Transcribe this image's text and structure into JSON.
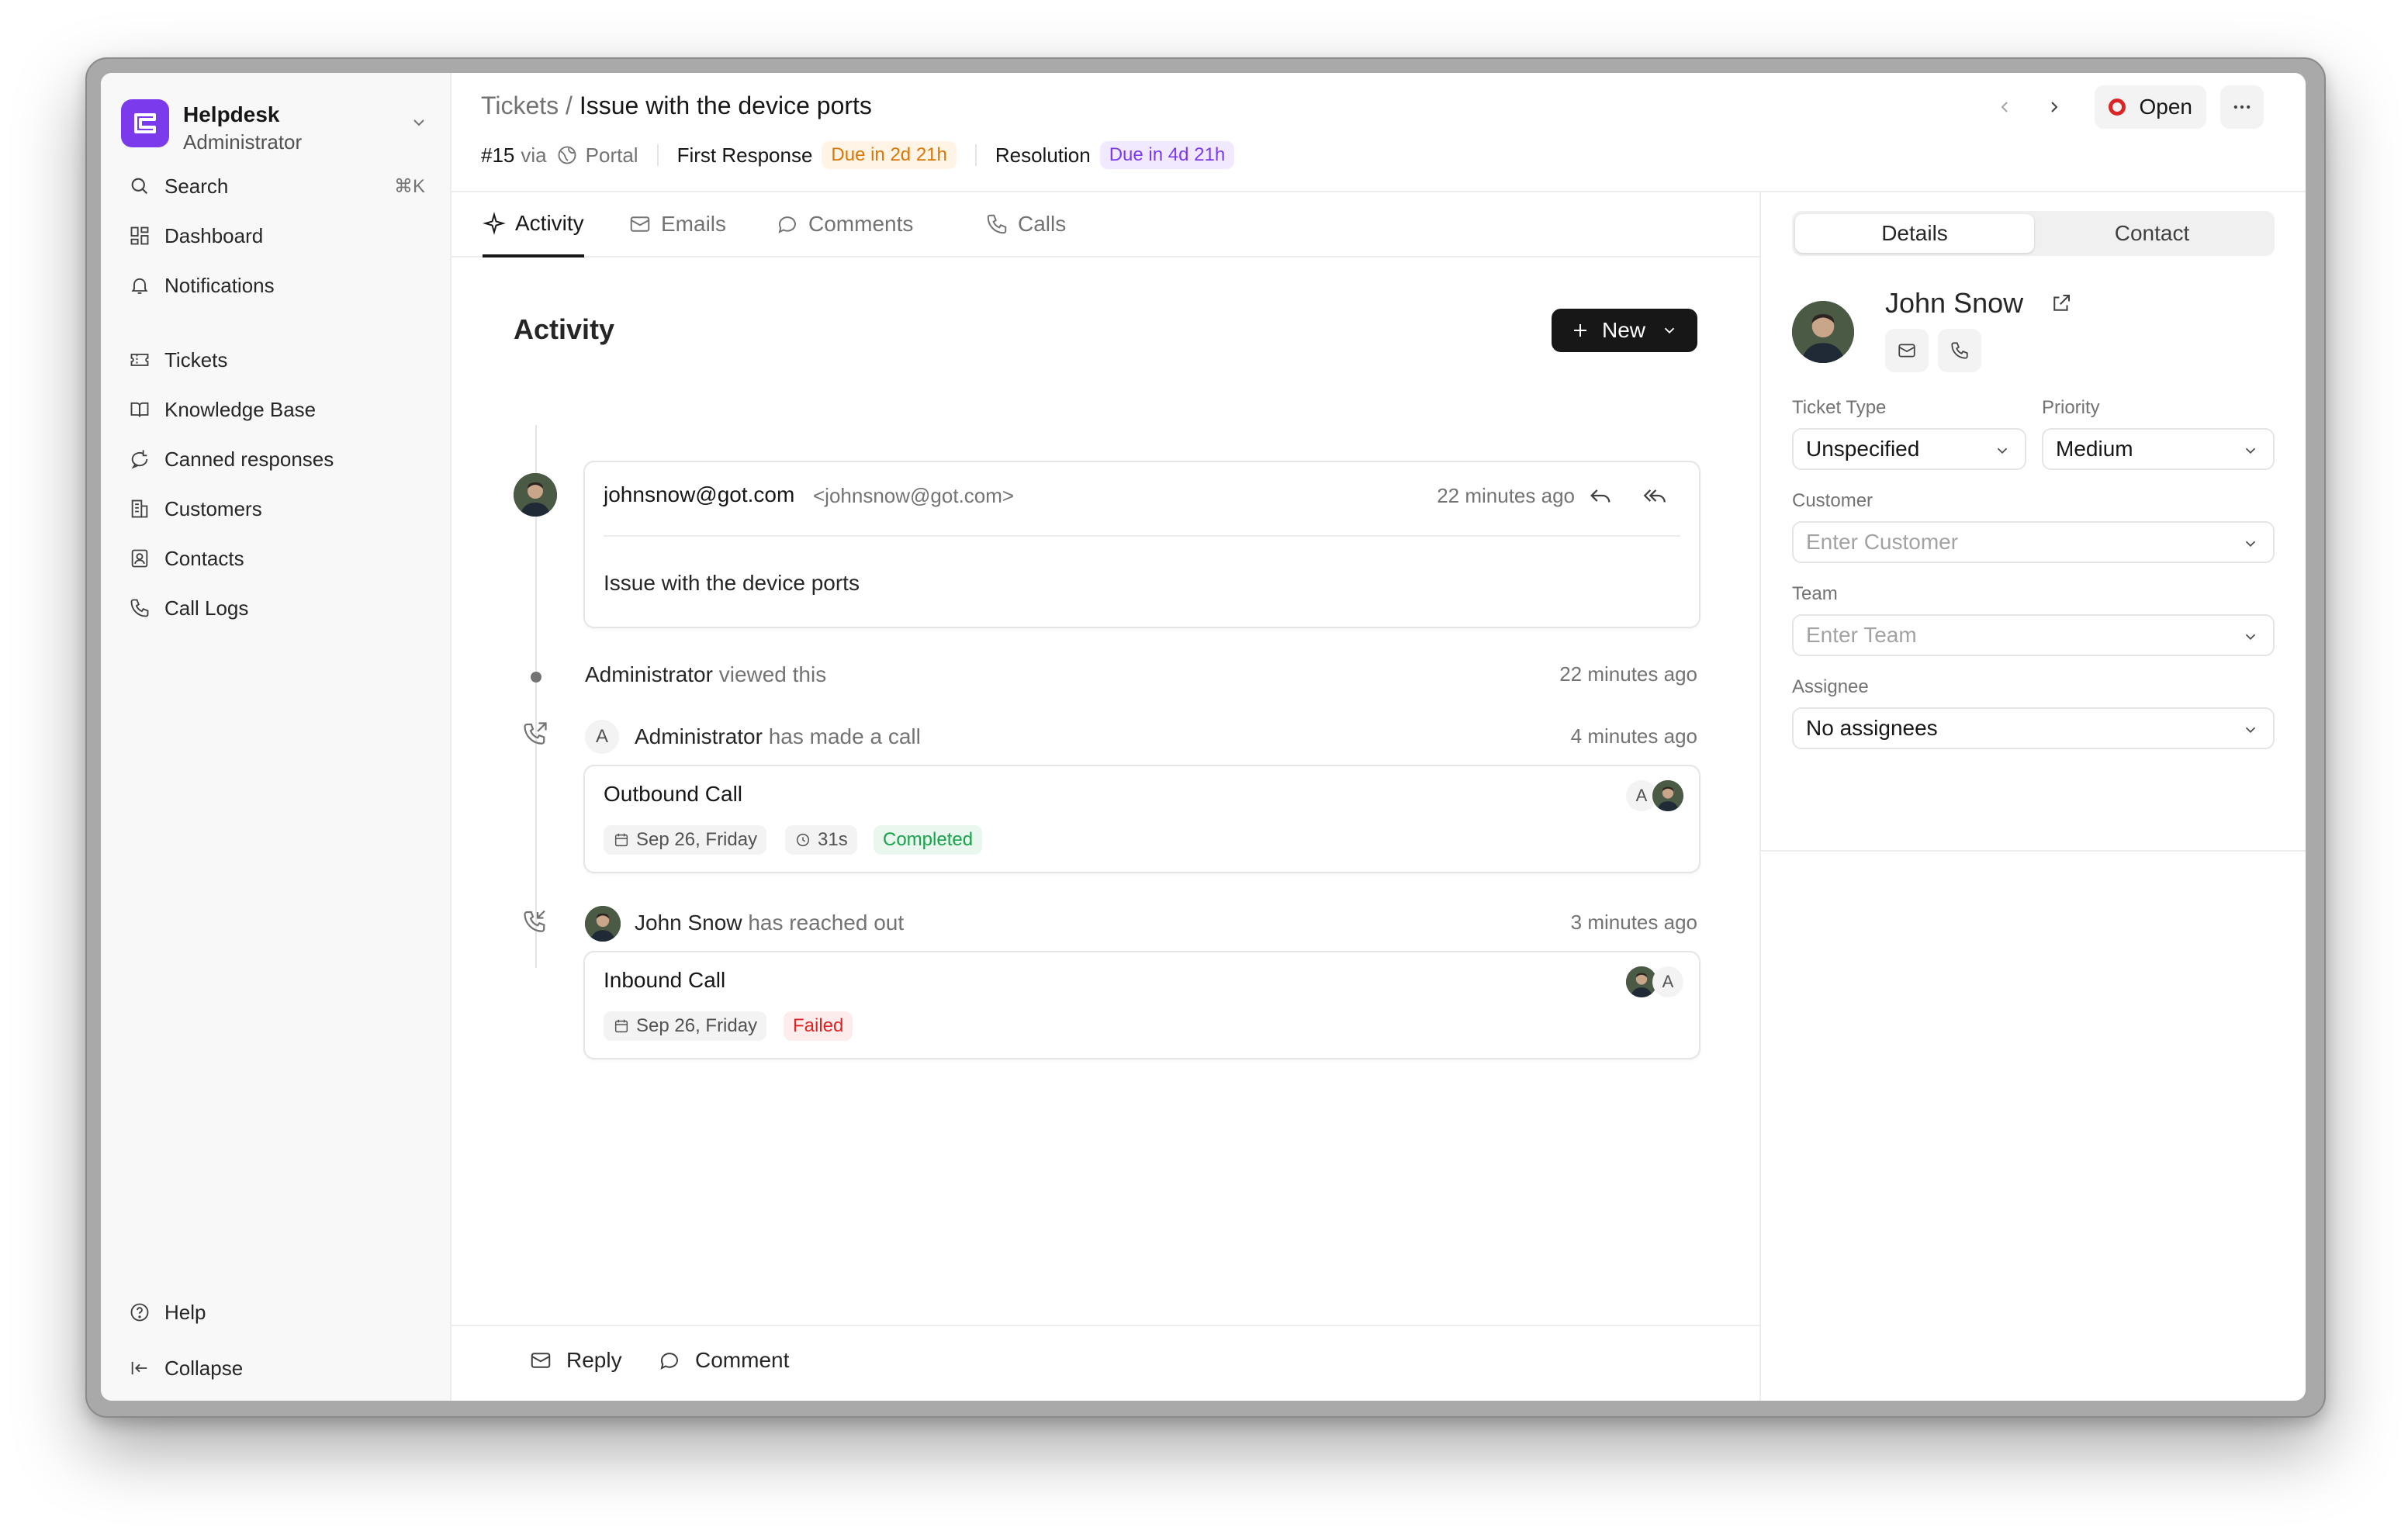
{
  "app": {
    "name": "Helpdesk",
    "role": "Administrator"
  },
  "sidebar": {
    "search": {
      "label": "Search",
      "shortcut": "⌘K"
    },
    "dashboard": "Dashboard",
    "notifications": "Notifications",
    "tickets": "Tickets",
    "knowledge_base": "Knowledge Base",
    "canned_responses": "Canned responses",
    "customers": "Customers",
    "contacts": "Contacts",
    "call_logs": "Call Logs",
    "help": "Help",
    "collapse": "Collapse"
  },
  "header": {
    "breadcrumb_root": "Tickets",
    "breadcrumb_sep": "/",
    "ticket_title": "Issue with the device ports",
    "ticket_id": "#15",
    "via": "via",
    "source": "Portal",
    "first_response_label": "First Response",
    "first_response_due": "Due in 2d 21h",
    "resolution_label": "Resolution",
    "resolution_due": "Due in 4d 21h",
    "status": "Open",
    "status_color": "#dc2626"
  },
  "tabs": [
    "Activity",
    "Emails",
    "Comments",
    "Calls"
  ],
  "activity": {
    "title": "Activity",
    "new_button": "New",
    "email": {
      "from_name": "johnsnow@got.com",
      "from_addr": "<johnsnow@got.com>",
      "time": "22 minutes ago",
      "body": "Issue with the device ports"
    },
    "view_event": {
      "who": "Administrator",
      "what": "viewed this",
      "time": "22 minutes ago"
    },
    "outbound_event": {
      "avatar_letter": "A",
      "who": "Administrator",
      "what": "has made a call",
      "time": "4 minutes ago",
      "card_title": "Outbound Call",
      "date": "Sep 26, Friday",
      "duration": "31s",
      "status": "Completed",
      "participant_letter": "A"
    },
    "inbound_event": {
      "who": "John Snow",
      "what": "has reached out",
      "time": "3 minutes ago",
      "card_title": "Inbound Call",
      "date": "Sep 26, Friday",
      "status": "Failed",
      "participant_letter": "A"
    }
  },
  "footer": {
    "reply": "Reply",
    "comment": "Comment"
  },
  "details": {
    "tab_details": "Details",
    "tab_contact": "Contact",
    "contact_name": "John Snow",
    "ticket_type_label": "Ticket Type",
    "ticket_type_value": "Unspecified",
    "priority_label": "Priority",
    "priority_value": "Medium",
    "customer_label": "Customer",
    "customer_placeholder": "Enter Customer",
    "team_label": "Team",
    "team_placeholder": "Enter Team",
    "assignee_label": "Assignee",
    "assignee_value": "No assignees"
  },
  "colors": {
    "brand": "#7c3aed",
    "completed": "#16a34a",
    "failed": "#dc2626",
    "first_response": "#d97706",
    "resolution": "#7c3aed"
  }
}
